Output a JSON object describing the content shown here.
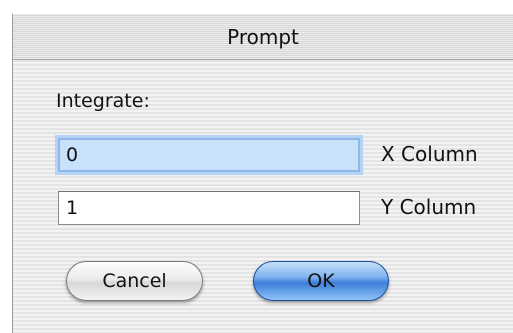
{
  "dialog": {
    "title": "Prompt",
    "prompt_label": "Integrate:",
    "x_field": {
      "value": "0",
      "label": "X Column"
    },
    "y_field": {
      "value": "1",
      "label": "Y Column"
    },
    "buttons": {
      "cancel_label": "Cancel",
      "ok_label": "OK"
    },
    "colors": {
      "focus_ring": "#8fb6e6",
      "focused_field_bg": "#c9e2fb",
      "default_button": "#3b7fd9"
    }
  }
}
